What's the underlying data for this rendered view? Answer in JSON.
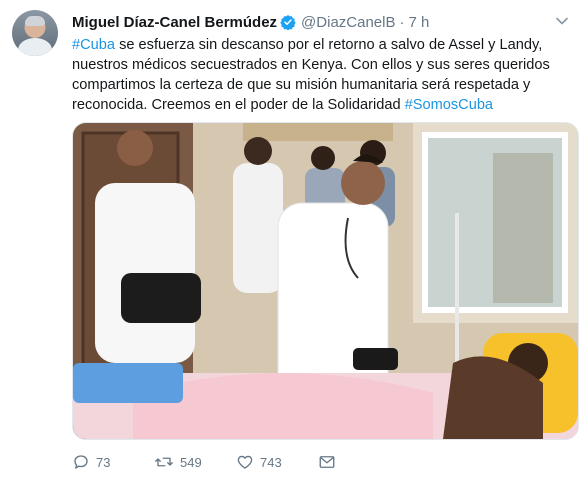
{
  "tweet": {
    "author_name": "Miguel Díaz-Canel Bermúdez",
    "handle": "@DiazCanelB",
    "separator": "·",
    "time": "7 h",
    "body": {
      "hashtag_start": "#Cuba",
      "text": " se esfuerza sin descanso por el retorno a salvo de Assel y Landy, nuestros médicos secuestrados en Kenya. Con ellos y sus seres queridos compartimos la certeza de que su misión humanitaria será respetada y reconocida. Creemos en el poder de la Solidaridad ",
      "hashtag_end": "#SomosCuba"
    },
    "stats": {
      "replies": "73",
      "retweets": "549",
      "likes": "743"
    }
  },
  "icons": {
    "verified": "verified-badge-icon",
    "more": "chevron-down-icon",
    "reply": "reply-icon",
    "retweet": "retweet-icon",
    "like": "heart-icon",
    "message": "envelope-icon"
  },
  "colors": {
    "link": "#1b95e0",
    "secondary_text": "#657786",
    "verified": "#1da1f2"
  }
}
